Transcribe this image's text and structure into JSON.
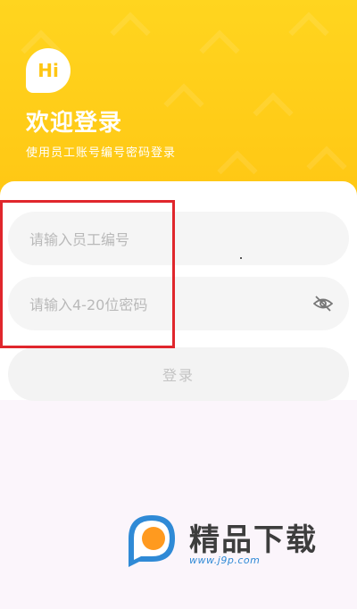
{
  "header": {
    "badge": "Hi",
    "title": "欢迎登录",
    "subtitle": "使用员工账号编号密码登录"
  },
  "form": {
    "employee_id_placeholder": "请输入员工编号",
    "password_placeholder": "请输入4-20位密码",
    "login_label": "登录"
  },
  "watermark": {
    "brand": "精品下载",
    "url": "www.j9p.com"
  },
  "colors": {
    "primary": "#ffc613",
    "highlight": "#e0262c"
  }
}
